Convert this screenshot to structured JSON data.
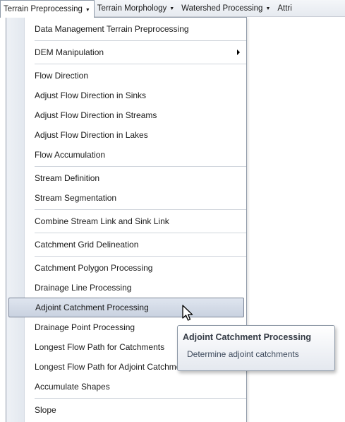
{
  "menubar": {
    "items": [
      {
        "label": "Terrain Preprocessing"
      },
      {
        "label": "Terrain Morphology"
      },
      {
        "label": "Watershed Processing"
      },
      {
        "label": "Attri"
      }
    ]
  },
  "dropdown": {
    "items": [
      {
        "label": "Data Management Terrain Preprocessing"
      },
      {
        "label": "DEM Manipulation"
      },
      {
        "label": "Flow Direction"
      },
      {
        "label": "Adjust Flow Direction in Sinks"
      },
      {
        "label": "Adjust Flow Direction in Streams"
      },
      {
        "label": "Adjust Flow Direction in Lakes"
      },
      {
        "label": "Flow Accumulation"
      },
      {
        "label": "Stream Definition"
      },
      {
        "label": "Stream Segmentation"
      },
      {
        "label": "Combine Stream Link and Sink Link"
      },
      {
        "label": "Catchment Grid Delineation"
      },
      {
        "label": "Catchment Polygon Processing"
      },
      {
        "label": "Drainage Line Processing"
      },
      {
        "label": "Adjoint Catchment Processing"
      },
      {
        "label": "Drainage Point Processing"
      },
      {
        "label": "Longest Flow Path for Catchments"
      },
      {
        "label": "Longest Flow Path for Adjoint Catchments"
      },
      {
        "label": "Accumulate Shapes"
      },
      {
        "label": "Slope"
      }
    ]
  },
  "tooltip": {
    "title": "Adjoint Catchment Processing",
    "description": "Determine adjoint catchments"
  },
  "icons": {
    "menu_dropdown_arrow": "triangle-down",
    "submenu_arrow": "triangle-right",
    "cursor": "arrow-pointer"
  }
}
